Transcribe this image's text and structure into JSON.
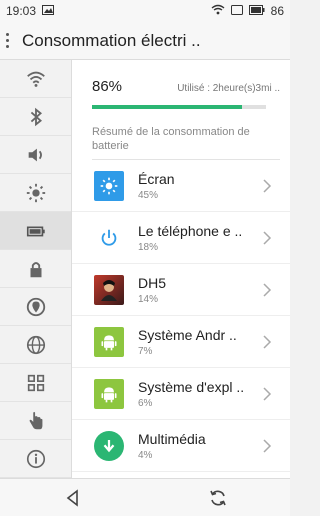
{
  "status": {
    "time": "19:03",
    "battery": "86"
  },
  "header": {
    "title": "Consommation électri .."
  },
  "sidebar": {
    "items": [
      {
        "icon": "wifi-icon"
      },
      {
        "icon": "bluetooth-icon"
      },
      {
        "icon": "volume-icon"
      },
      {
        "icon": "brightness-icon"
      },
      {
        "icon": "battery-icon",
        "active": true
      },
      {
        "icon": "lock-icon"
      },
      {
        "icon": "location-icon"
      },
      {
        "icon": "globe-icon"
      },
      {
        "icon": "grid-icon"
      },
      {
        "icon": "hand-pointer-icon"
      },
      {
        "icon": "info-icon"
      }
    ]
  },
  "usage": {
    "percent": "86%",
    "used_text": "Utilisé : 2heure(s)3mi ..",
    "level": 0.86,
    "bar_color": "#2bb673"
  },
  "summary_label": "Résumé de la consommation de batterie",
  "apps": [
    {
      "name": "Écran",
      "percent": "45%",
      "icon": "screen-brightness-icon",
      "color": "#2f9be8"
    },
    {
      "name": "Le téléphone e ..",
      "percent": "18%",
      "icon": "power-icon",
      "color": "#ffffff"
    },
    {
      "name": "DH5",
      "percent": "14%",
      "icon": "game-icon",
      "color": "#8a2b2b"
    },
    {
      "name": "Système Andr ..",
      "percent": "7%",
      "icon": "android-icon",
      "color": "#8dc63f"
    },
    {
      "name": "Système d'expl ..",
      "percent": "6%",
      "icon": "android-icon",
      "color": "#8dc63f"
    },
    {
      "name": "Multimédia",
      "percent": "4%",
      "icon": "download-icon",
      "color": "#2bb673"
    }
  ]
}
